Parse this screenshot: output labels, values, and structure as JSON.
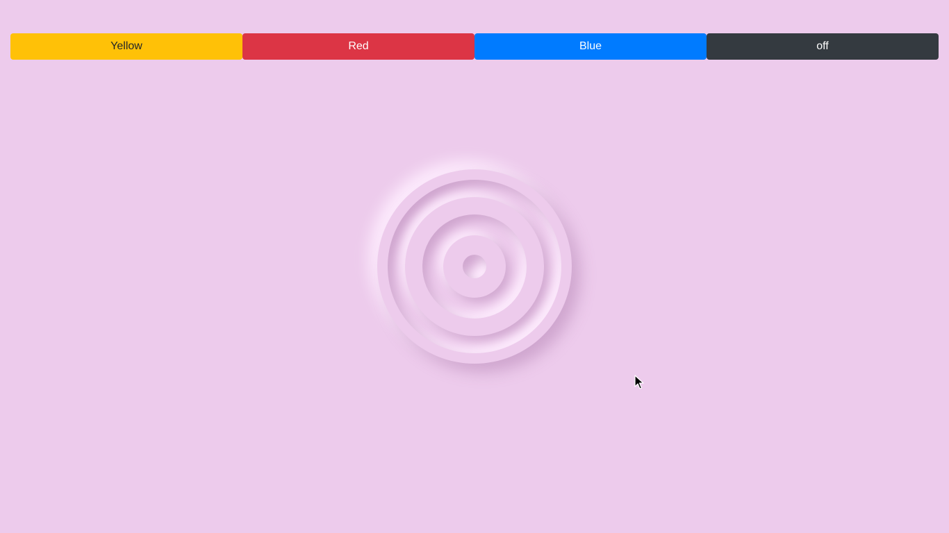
{
  "buttons": {
    "yellow": {
      "label": "Yellow",
      "color": "#ffc107"
    },
    "red": {
      "label": "Red",
      "color": "#dc3545"
    },
    "blue": {
      "label": "Blue",
      "color": "#007bff"
    },
    "off": {
      "label": "off",
      "color": "#343a40"
    }
  },
  "theme": {
    "background": "#edcbec"
  },
  "lamp": {
    "state": "off",
    "icon": "concentric-rings-lamp-icon"
  }
}
